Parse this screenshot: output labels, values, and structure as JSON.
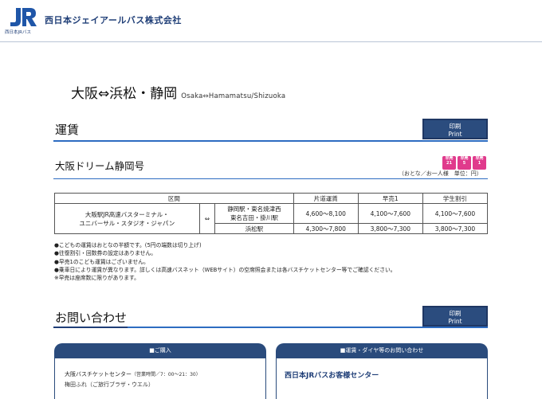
{
  "header": {
    "logo_text": "JR",
    "logo_caption": "西日本JRバス",
    "company_name": "西日本ジェイアールバス株式会社"
  },
  "route": {
    "title": "大阪⇔浜松・静岡",
    "subtitle": "Osaka⇔Hamamatsu/Shizuoka"
  },
  "fare_section": {
    "title": "運賃",
    "print_label_ja": "印刷",
    "print_label_en": "Print",
    "service_name": "大阪ドリーム静岡号",
    "badges": [
      {
        "text": "早売\n21",
        "color": "#e03a8c"
      },
      {
        "text": "早売\n5",
        "color": "#e03a8c"
      },
      {
        "text": "早売\n1",
        "color": "#e03a8c"
      }
    ],
    "unit_note": "（おとな／お一人様　単位：円）",
    "table": {
      "headers": [
        "区間",
        "片道運賃",
        "早売1",
        "学生割引"
      ],
      "origin": "大阪駅JR高速バスターミナル・\nユニバーサル・スタジオ・ジャパン",
      "arrow": "⇔",
      "rows": [
        {
          "dest": "静岡駅・東名焼津西\n東名吉田・掛川駅",
          "fare": "4,600〜8,100",
          "early": "4,100〜7,600",
          "student": "4,100〜7,600"
        },
        {
          "dest": "浜松駅",
          "fare": "4,300〜7,800",
          "early": "3,800〜7,300",
          "student": "3,800〜7,300"
        }
      ]
    },
    "notes": [
      "●こどもの運賃はおとなの半額です。(5円の端数は切り上げ)",
      "●往復割引・回数券の設定はありません。",
      "●早売1のこども運賃はございません。",
      "●乗車日により運賃が異なります。詳しくは高速バスネット（WEBサイト）の空席照会または各バスチケットセンター等でご確認ください。",
      "※早売は座席数に限りがあります。"
    ]
  },
  "contact_section": {
    "title": "お問い合わせ",
    "print_label_ja": "印刷",
    "print_label_en": "Print",
    "left_card": {
      "heading": "■ご購入",
      "center_name": "大阪バスチケットセンター",
      "center_hours": "（営業時間／7：00〜21：30）",
      "next_line": "梅田ふれ（ご旅行ブラザ・ウエル）"
    },
    "right_card": {
      "heading": "■運賃・ダイヤ等のお問い合わせ",
      "center_name": "西日本JRバスお客様センター"
    }
  },
  "colors": {
    "brand_navy": "#1f3e77",
    "rule_blue": "#2d6cc1",
    "button_navy": "#2b4c7e",
    "badge_pink": "#e03a8c"
  }
}
